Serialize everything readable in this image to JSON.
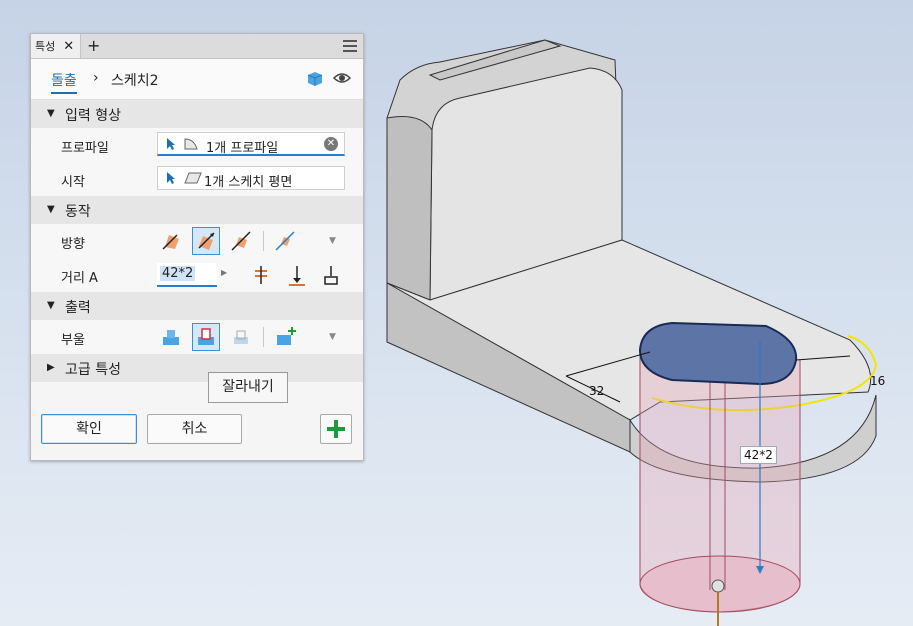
{
  "panel": {
    "tab_label": "특성",
    "tab_close": "✕",
    "tab_add": "+",
    "breadcrumb": {
      "feature": "돌출",
      "separator": "›",
      "sketch": "스케치2"
    },
    "sections": {
      "input_geometry": {
        "title": "입력 형상",
        "profile_label": "프로파일",
        "profile_value": "1개 프로파일",
        "start_label": "시작",
        "start_value": "1개 스케치 평면"
      },
      "behavior": {
        "title": "동작",
        "direction_label": "방향",
        "distance_label": "거리 A",
        "distance_value": "42*2"
      },
      "output": {
        "title": "출력",
        "boolean_label": "부울"
      },
      "advanced": {
        "title": "고급 특성"
      }
    },
    "buttons": {
      "ok": "확인",
      "cancel": "취소"
    },
    "tooltip": "잘라내기"
  },
  "viewport": {
    "dimensions": {
      "width_dim": "32",
      "radius_dim": "16",
      "distance_dim": "42*2"
    }
  },
  "colors": {
    "accent": "#1a6fb5",
    "highlight_edge": "#f2e600",
    "cut_preview": "#e8a6b5",
    "add_icon": "#1f9a3a"
  }
}
